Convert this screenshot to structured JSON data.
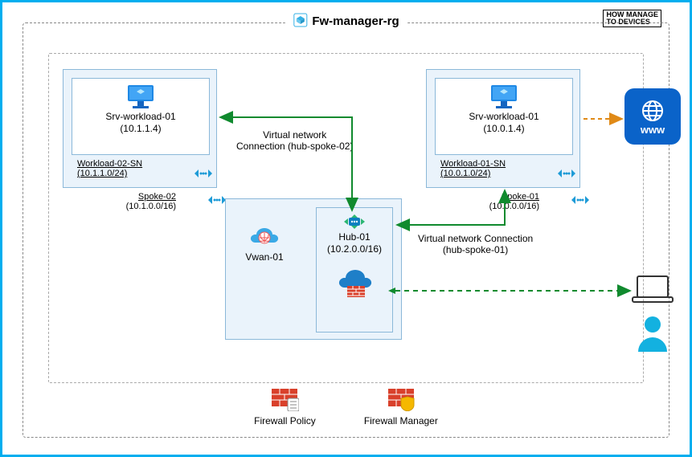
{
  "resource_group": {
    "title": "Fw-manager-rg"
  },
  "watermark": {
    "line1": "HOW",
    "line2": "MANAGE",
    "line3": "TO",
    "line4": "DEVICES"
  },
  "spoke02": {
    "box_label": "Spoke-02",
    "box_cidr": "(10.1.0.0/16)",
    "subnet_label": "Workload-02-SN",
    "subnet_cidr": "(10.1.1.0/24)",
    "vm_label": "Srv-workload-01",
    "vm_ip": "(10.1.1.4)"
  },
  "spoke01": {
    "box_label": "Spoke-01",
    "box_cidr": "(10.0.0.0/16)",
    "subnet_label": "Workload-01-SN",
    "subnet_cidr": "(10.0.1.0/24)",
    "vm_label": "Srv-workload-01",
    "vm_ip": "(10.0.1.4)"
  },
  "connections": {
    "spoke02_label_1": "Virtual network",
    "spoke02_label_2": "Connection (hub-spoke-02)",
    "spoke01_label_1": "Virtual network Connection",
    "spoke01_label_2": "(hub-spoke-01)"
  },
  "hub": {
    "vwan_label": "Vwan-01",
    "hub_label": "Hub-01",
    "hub_cidr": "(10.2.0.0/16)"
  },
  "legend": {
    "firewall_policy": "Firewall Policy",
    "firewall_manager": "Firewall Manager"
  },
  "external": {
    "www": "www"
  },
  "icons": {
    "resource_group": "rg",
    "vm": "vm",
    "vnet": "vnet",
    "vwan": "vwan",
    "hub": "hub",
    "firewall": "firewall",
    "www": "www",
    "laptop": "laptop",
    "user": "user",
    "firewall_policy": "firewall-policy",
    "firewall_manager": "firewall-manager"
  }
}
